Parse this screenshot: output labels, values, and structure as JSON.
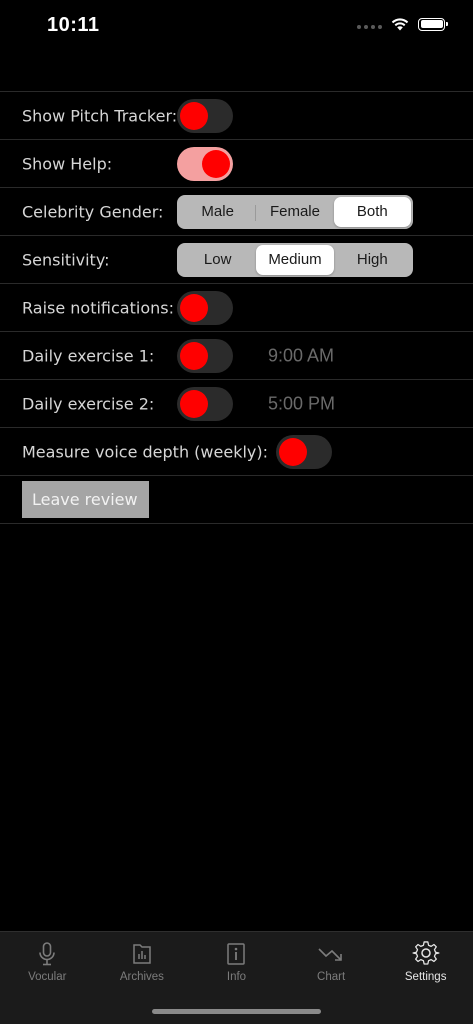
{
  "status": {
    "time": "10:11"
  },
  "settings": {
    "pitch_tracker": {
      "label": "Show Pitch Tracker:",
      "on": false
    },
    "help": {
      "label": "Show Help:",
      "on": true
    },
    "gender": {
      "label": "Celebrity Gender:",
      "options": [
        "Male",
        "Female",
        "Both"
      ],
      "selected": "Both"
    },
    "sensitivity": {
      "label": "Sensitivity:",
      "options": [
        "Low",
        "Medium",
        "High"
      ],
      "selected": "Medium"
    },
    "notifications": {
      "label": "Raise notifications:",
      "on": false
    },
    "exercise1": {
      "label": "Daily exercise 1:",
      "on": false,
      "time": "9:00 AM"
    },
    "exercise2": {
      "label": "Daily exercise 2:",
      "on": false,
      "time": "5:00 PM"
    },
    "voice_depth": {
      "label": "Measure voice depth (weekly):",
      "on": false
    },
    "review_button": "Leave review"
  },
  "tab_bar": {
    "items": [
      {
        "label": "Vocular",
        "icon": "microphone-icon"
      },
      {
        "label": "Archives",
        "icon": "archives-icon"
      },
      {
        "label": "Info",
        "icon": "info-icon"
      },
      {
        "label": "Chart",
        "icon": "chart-icon"
      },
      {
        "label": "Settings",
        "icon": "gear-icon"
      }
    ],
    "active": "Settings"
  },
  "colors": {
    "background": "#000000",
    "toggle_knob": "#ff0000",
    "toggle_on_track": "#f4a0a0",
    "toggle_off_track": "#2b2b2b",
    "tab_bar": "#1b1b1b"
  }
}
